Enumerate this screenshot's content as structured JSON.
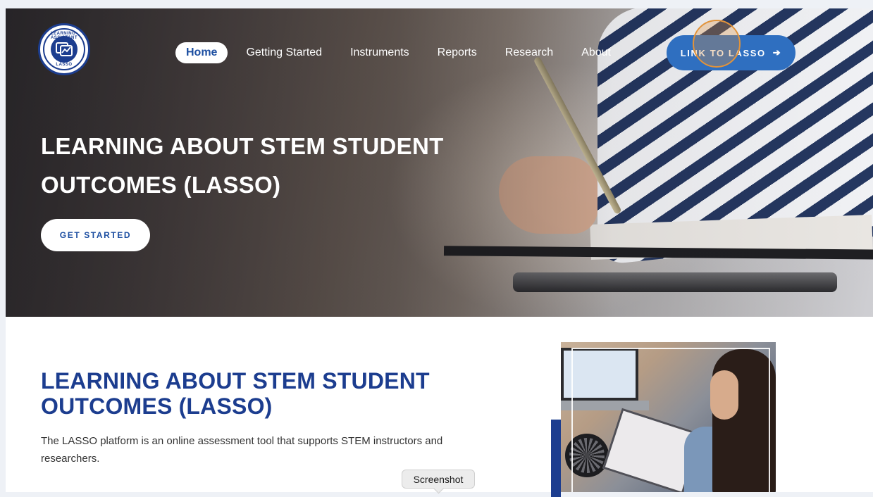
{
  "logo": {
    "arc_top": "LEARNING ASSISTANT",
    "arc_bottom": "LASSO",
    "icon": "lasso-logo-icon"
  },
  "nav": {
    "items": [
      {
        "label": "Home",
        "active": true
      },
      {
        "label": "Getting Started",
        "active": false
      },
      {
        "label": "Instruments",
        "active": false
      },
      {
        "label": "Reports",
        "active": false
      },
      {
        "label": "Research",
        "active": false
      },
      {
        "label": "About",
        "active": false
      }
    ]
  },
  "cta": {
    "label": "LINK TO LASSO",
    "icon": "arrow-right-icon",
    "arrow_glyph": "➔"
  },
  "hero": {
    "title": "LEARNING ABOUT STEM STUDENT OUTCOMES (LASSO)",
    "button_label": "GET STARTED"
  },
  "content": {
    "title": "LEARNING ABOUT STEM STUDENT OUTCOMES (LASSO)",
    "description": "The LASSO platform is an online assessment tool that supports STEM instructors and researchers."
  },
  "tooltip": {
    "label": "Screenshot"
  },
  "colors": {
    "brand_blue": "#1c3d8f",
    "nav_active_text": "#1c4ea1",
    "cta_bg": "#2f6fc0",
    "cursor_highlight": "#e2933a"
  }
}
